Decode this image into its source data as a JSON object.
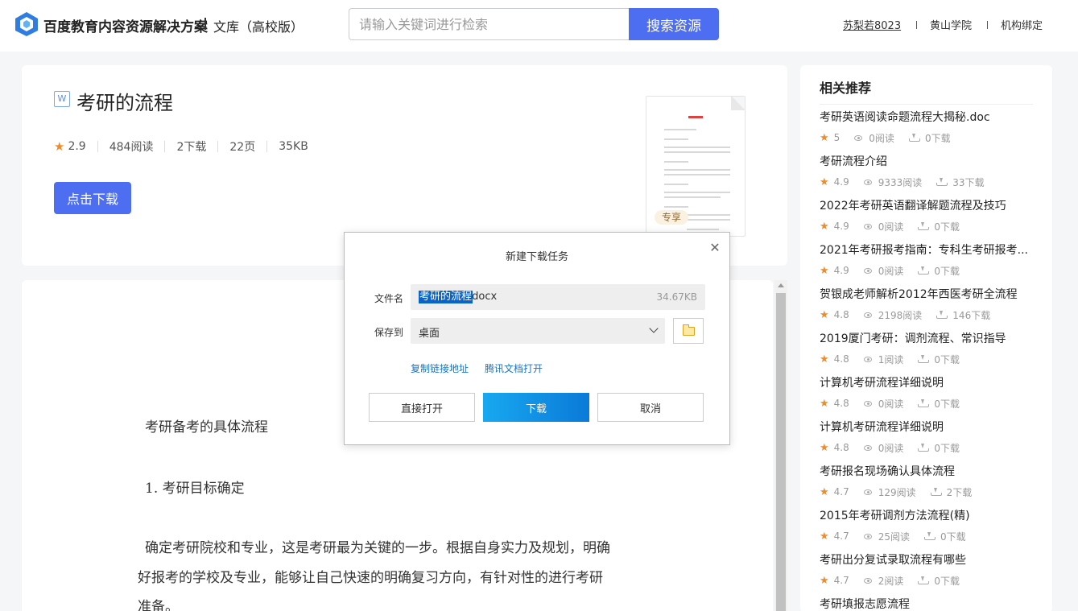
{
  "header": {
    "brand": "百度教育内容资源解决方案",
    "sub": "文库（高校版）",
    "search_placeholder": "请输入关键词进行检索",
    "search_button": "搜索资源",
    "user": "苏梨若8023",
    "school": "黄山学院",
    "bind": "机构绑定"
  },
  "doc": {
    "type_icon": "W",
    "title": "考研的流程",
    "rating": "2.9",
    "reads": "484阅读",
    "downloads": "2下载",
    "pages": "22页",
    "size": "35KB",
    "download_button": "点击下载",
    "badge": "专享"
  },
  "doc_body": {
    "heading": "考研备考的具体流程",
    "section1": "1. 考研目标确定",
    "para1_line1": "确定考研院校和专业，这是考研最为关键的一步。根据自身实力及规划，明确",
    "para1_line2": "好报考的学校及专业，能够让自己快速的明确复习方向，有针对性的进行考研",
    "para1_line3": "准备。"
  },
  "sidebar": {
    "title": "相关推荐",
    "items": [
      {
        "title": "考研英语阅读命题流程大揭秘.doc",
        "rating": "5",
        "reads": "0阅读",
        "downloads": "0下载"
      },
      {
        "title": "考研流程介绍",
        "rating": "4.9",
        "reads": "9333阅读",
        "downloads": "33下载"
      },
      {
        "title": "2022年考研英语翻译解题流程及技巧",
        "rating": "4.9",
        "reads": "0阅读",
        "downloads": "0下载"
      },
      {
        "title": "2021年考研报考指南：专科生考研报考...",
        "rating": "4.9",
        "reads": "0阅读",
        "downloads": "0下载"
      },
      {
        "title": "贺银成老师解析2012年西医考研全流程",
        "rating": "4.8",
        "reads": "2198阅读",
        "downloads": "146下载"
      },
      {
        "title": "2019厦门考研：调剂流程、常识指导",
        "rating": "4.8",
        "reads": "1阅读",
        "downloads": "0下载"
      },
      {
        "title": "计算机考研流程详细说明",
        "rating": "4.8",
        "reads": "0阅读",
        "downloads": "0下载"
      },
      {
        "title": "计算机考研流程详细说明",
        "rating": "4.8",
        "reads": "0阅读",
        "downloads": "0下载"
      },
      {
        "title": "考研报名现场确认具体流程",
        "rating": "4.7",
        "reads": "129阅读",
        "downloads": "2下载"
      },
      {
        "title": "2015年考研调剂方法流程(精)",
        "rating": "4.7",
        "reads": "25阅读",
        "downloads": "0下载"
      },
      {
        "title": "考研出分复试录取流程有哪些",
        "rating": "4.7",
        "reads": "2阅读",
        "downloads": "0下载"
      },
      {
        "title": "考研填报志愿流程",
        "rating": "",
        "reads": "",
        "downloads": ""
      }
    ]
  },
  "modal": {
    "title": "新建下载任务",
    "filename_label": "文件名",
    "filename_selected": "考研的流程",
    "filename_ext": ".docx",
    "filesize": "34.67KB",
    "saveto_label": "保存到",
    "saveto_value": "桌面",
    "copy_link": "复制链接地址",
    "tencent_open": "腾讯文档打开",
    "open_button": "直接打开",
    "download_button": "下载",
    "cancel_button": "取消"
  },
  "colors": {
    "accent": "#4e6ef2",
    "star": "#f18b2a",
    "link": "#1a73c8"
  }
}
